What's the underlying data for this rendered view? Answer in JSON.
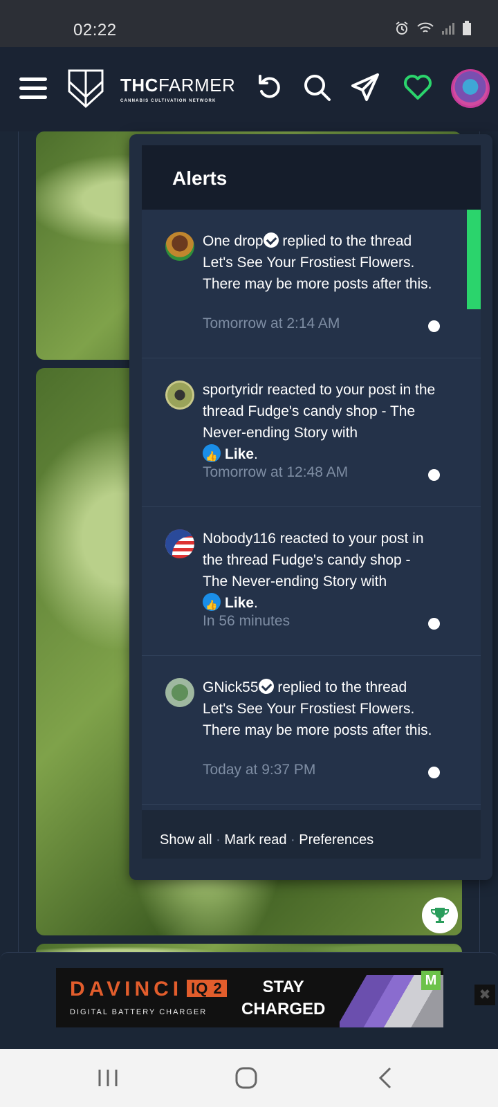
{
  "status_bar": {
    "time": "02:22"
  },
  "header": {
    "brand_bold": "THC",
    "brand_light": "FARMER",
    "brand_tagline": "CANNABIS CULTIVATION NETWORK"
  },
  "alerts": {
    "title": "Alerts",
    "items": [
      {
        "user": "One drop",
        "verified": true,
        "text": "replied to the thread Let's See Your Frostiest Flowers. There may be more posts after this.",
        "time": "Tomorrow at 2:14 AM"
      },
      {
        "user": "sportyridr",
        "text": "reacted to your post in the thread Fudge's candy shop - The Never-ending Story with",
        "reaction": "Like",
        "time": "Tomorrow at 12:48 AM"
      },
      {
        "user": "Nobody116",
        "text": "reacted to your post in the thread Fudge's candy shop - The Never-ending Story with",
        "reaction": "Like",
        "time": "In 56 minutes"
      },
      {
        "user": "GNick55",
        "verified": true,
        "text": "replied to the thread Let's See Your Frostiest Flowers. There may be more posts after this.",
        "time": "Today at 9:37 PM"
      }
    ],
    "footer": {
      "show_all": "Show all",
      "mark_read": "Mark read",
      "preferences": "Preferences",
      "separator": "·"
    }
  },
  "ad": {
    "brand": "DAVINCI",
    "model": "IQ 2",
    "subtitle": "DIGITAL BATTERY CHARGER",
    "slogan_line1": "STAY",
    "slogan_line2": "CHARGED",
    "badge": "M"
  },
  "colors": {
    "accent_green": "#2bd46c",
    "header_bg": "#1a2333",
    "panel_bg": "#243249",
    "muted_text": "#7e8da3"
  }
}
